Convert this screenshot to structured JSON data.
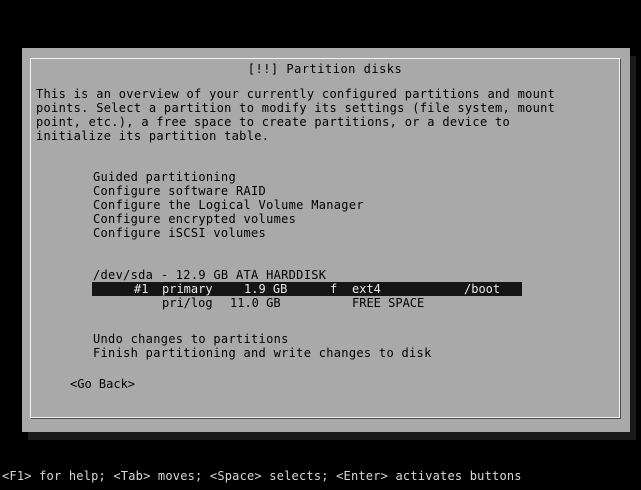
{
  "dialog": {
    "title": "[!!] Partition disks",
    "intro_lines": [
      "This is an overview of your currently configured partitions and mount",
      "points. Select a partition to modify its settings (file system, mount",
      "point, etc.), a free space to create partitions, or a device to",
      "initialize its partition table."
    ],
    "menu": [
      "Guided partitioning",
      "Configure software RAID",
      "Configure the Logical Volume Manager",
      "Configure encrypted volumes",
      "Configure iSCSI volumes"
    ],
    "disk": "/dev/sda - 12.9 GB ATA HARDDISK",
    "partitions": [
      {
        "number": "#1",
        "type": "primary",
        "size": "1.9 GB",
        "flag": "f",
        "fs": "ext4",
        "mount": "/boot"
      },
      {
        "type": "pri/log",
        "size": "11.0 GB",
        "fs": "FREE SPACE"
      }
    ],
    "actions": [
      "Undo changes to partitions",
      "Finish partitioning and write changes to disk"
    ],
    "go_back": "<Go Back>"
  },
  "help_bar": "<F1> for help; <Tab> moves; <Space> selects; <Enter> activates buttons"
}
